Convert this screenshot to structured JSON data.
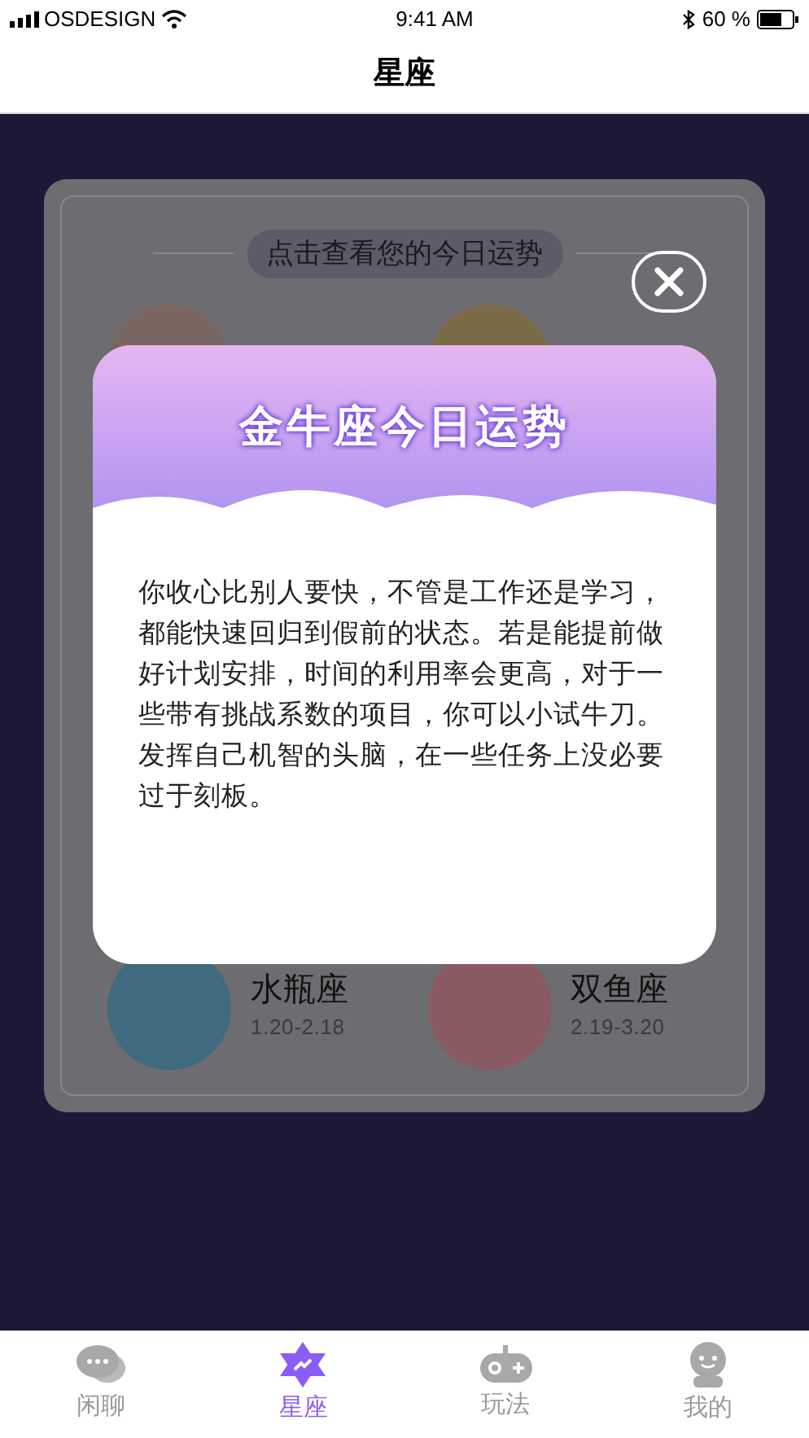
{
  "status_bar": {
    "carrier": "OSDESIGN",
    "time": "9:41 AM",
    "battery": "60 %"
  },
  "header": {
    "title": "星座"
  },
  "card": {
    "prompt": "点击查看您的今日运势",
    "signs": [
      {
        "name": "水瓶座",
        "dates": "1.20-2.18"
      },
      {
        "name": "双鱼座",
        "dates": "2.19-3.20"
      }
    ]
  },
  "modal": {
    "title": "金牛座今日运势",
    "body": "你收心比别人要快，不管是工作还是学习，都能快速回归到假前的状态。若是能提前做好计划安排，时间的利用率会更高，对于一些带有挑战系数的项目，你可以小试牛刀。发挥自己机智的头脑，在一些任务上没必要过于刻板。"
  },
  "tabs": [
    {
      "label": "闲聊",
      "selected": false
    },
    {
      "label": "星座",
      "selected": true
    },
    {
      "label": "玩法",
      "selected": false
    },
    {
      "label": "我的",
      "selected": false
    }
  ]
}
